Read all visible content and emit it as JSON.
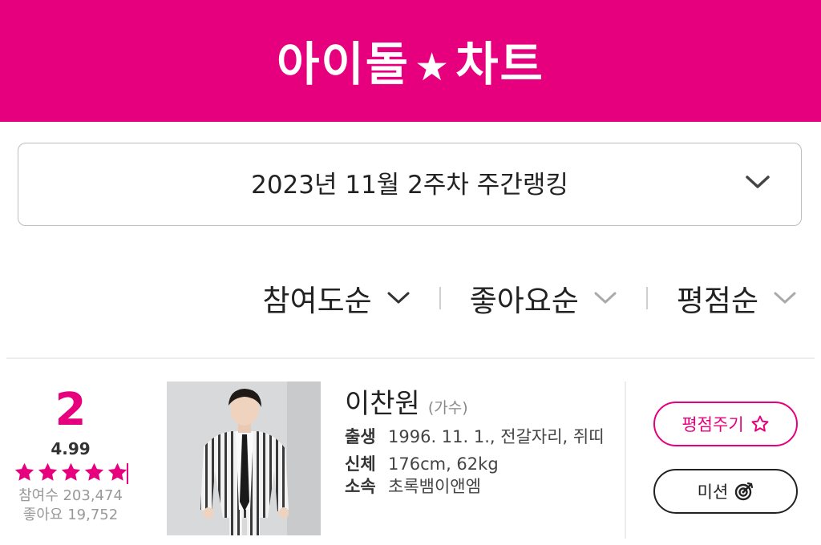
{
  "header": {
    "logo_left": "아이돌",
    "logo_star": "★",
    "logo_right": "차트",
    "bg_color": "#e6007e"
  },
  "week_selector": {
    "label": "2023년 11월 2주차 주간랭킹",
    "icon": "chevron-down-icon"
  },
  "sort_options": [
    {
      "label": "참여도순",
      "icon": "chevron-down-icon",
      "active": true
    },
    {
      "label": "좋아요순",
      "icon": "chevron-down-icon",
      "active": false
    },
    {
      "label": "평점순",
      "icon": "chevron-down-icon",
      "active": false
    }
  ],
  "entry": {
    "rank": "2",
    "rating": "4.99",
    "stars_filled": 5,
    "participants": "참여수 203,474",
    "likes": "좋아요 19,752",
    "name": "이찬원",
    "role": "(가수)",
    "details": [
      {
        "key": "출생",
        "value": "1996. 11. 1., 전갈자리, 쥐띠"
      },
      {
        "key": "신체",
        "value": "176cm, 62kg"
      },
      {
        "key": "소속",
        "value": "초록뱀이앤엠"
      }
    ],
    "rate_button": "평점주기",
    "mission_button": "미션"
  },
  "colors": {
    "accent": "#e6007e",
    "text": "#222222",
    "muted": "#999999"
  }
}
